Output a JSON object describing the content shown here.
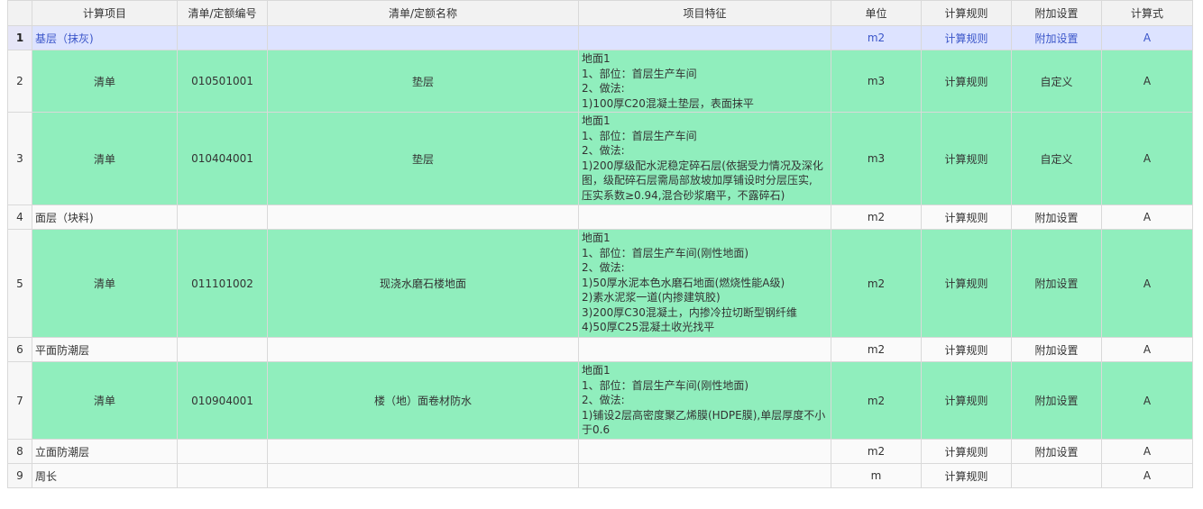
{
  "columns": [
    "",
    "计算项目",
    "清单/定额编号",
    "清单/定额名称",
    "项目特征",
    "单位",
    "计算规则",
    "附加设置",
    "计算式"
  ],
  "rows": [
    {
      "no": "1",
      "item": "基层（抹灰)",
      "code": "",
      "name": "",
      "feature": [],
      "unit": "m2",
      "rule": "计算规则",
      "extra": "附加设置",
      "formula": "A",
      "style": "selected"
    },
    {
      "no": "2",
      "item": "清单",
      "code": "010501001",
      "name": "垫层",
      "feature": [
        "地面1",
        "1、部位：首层生产车间",
        "2、做法:",
        "1)100厚C20混凝土垫层，表面抹平"
      ],
      "unit": "m3",
      "rule": "计算规则",
      "extra": "自定义",
      "formula": "A",
      "style": "green"
    },
    {
      "no": "3",
      "item": "清单",
      "code": "010404001",
      "name": "垫层",
      "feature": [
        "地面1",
        "1、部位：首层生产车间",
        "2、做法:",
        "1)200厚级配水泥稳定碎石层(依据受力情况及深化",
        "图，级配碎石层需局部放坡加厚铺设时分层压实,",
        "压实系数≥0.94,混合砂浆磨平，不露碎石)"
      ],
      "unit": "m3",
      "rule": "计算规则",
      "extra": "自定义",
      "formula": "A",
      "style": "green"
    },
    {
      "no": "4",
      "item": "面层（块料)",
      "code": "",
      "name": "",
      "feature": [],
      "unit": "m2",
      "rule": "计算规则",
      "extra": "附加设置",
      "formula": "A",
      "style": "plain"
    },
    {
      "no": "5",
      "item": "清单",
      "code": "011101002",
      "name": "现浇水磨石楼地面",
      "feature": [
        "地面1",
        "1、部位：首层生产车间(刚性地面)",
        "2、做法:",
        "1)50厚水泥本色水磨石地面(燃烧性能A级)",
        "2)素水泥浆一道(内掺建筑胶)",
        "3)200厚C30混凝土，内掺冷拉切断型钢纤维",
        "4)50厚C25混凝土收光找平"
      ],
      "unit": "m2",
      "rule": "计算规则",
      "extra": "附加设置",
      "formula": "A",
      "style": "green"
    },
    {
      "no": "6",
      "item": "平面防潮层",
      "code": "",
      "name": "",
      "feature": [],
      "unit": "m2",
      "rule": "计算规则",
      "extra": "附加设置",
      "formula": "A",
      "style": "plain"
    },
    {
      "no": "7",
      "item": "清单",
      "code": "010904001",
      "name": "楼（地）面卷材防水",
      "feature": [
        "地面1",
        "1、部位：首层生产车间(刚性地面)",
        "2、做法:",
        "1)铺设2层高密度聚乙烯膜(HDPE膜),单层厚度不小",
        "于0.6"
      ],
      "unit": "m2",
      "rule": "计算规则",
      "extra": "附加设置",
      "formula": "A",
      "style": "green"
    },
    {
      "no": "8",
      "item": "立面防潮层",
      "code": "",
      "name": "",
      "feature": [],
      "unit": "m2",
      "rule": "计算规则",
      "extra": "附加设置",
      "formula": "A",
      "style": "plain"
    },
    {
      "no": "9",
      "item": "周长",
      "code": "",
      "name": "",
      "feature": [],
      "unit": "m",
      "rule": "计算规则",
      "extra": "",
      "formula": "A",
      "style": "plain"
    }
  ],
  "colors": {
    "green": "#90eebd",
    "selected": "#dde3ff",
    "selected_text": "#3b56c9"
  }
}
